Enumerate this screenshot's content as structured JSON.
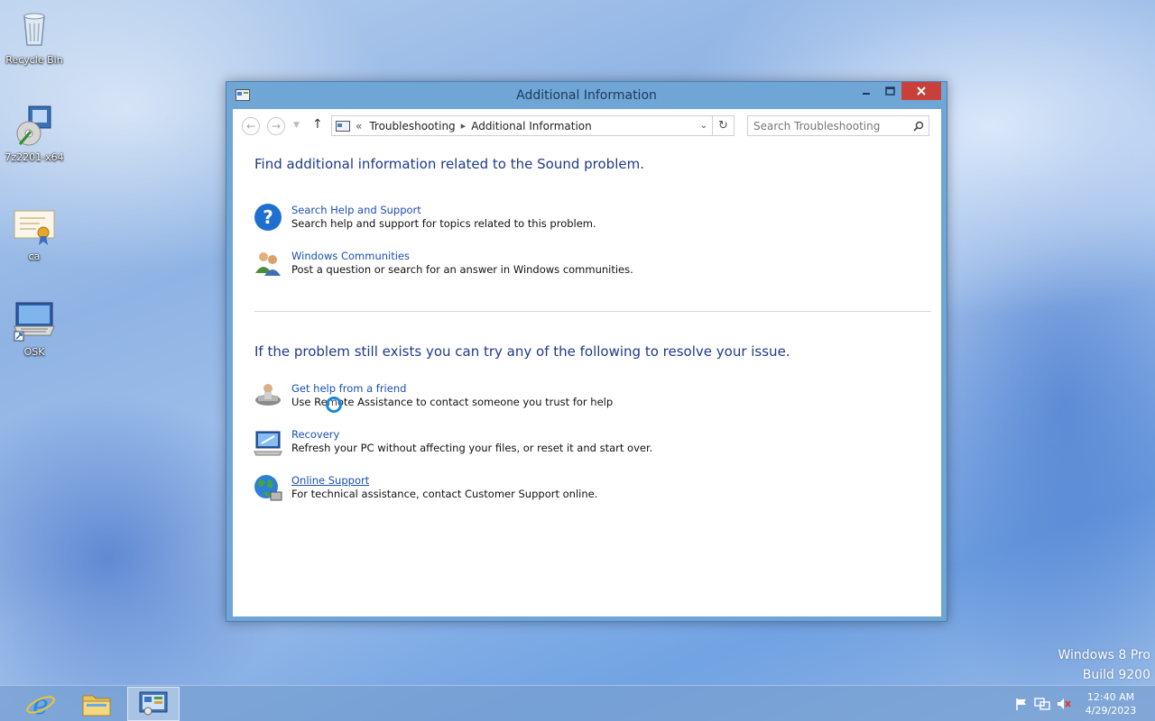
{
  "desktop": {
    "icons": [
      {
        "label": "Recycle Bin",
        "icon": "recycle-bin-icon"
      },
      {
        "label": "7z2201-x64",
        "icon": "installer-icon"
      },
      {
        "label": "ca",
        "icon": "certificate-icon"
      },
      {
        "label": "OSK",
        "icon": "keyboard-shortcut-icon"
      }
    ],
    "watermark": {
      "line1": "Windows 8 Pro",
      "line2": "Build 9200"
    }
  },
  "window": {
    "title": "Additional Information",
    "address": {
      "prefix": "«",
      "crumbs": [
        "Troubleshooting",
        "Additional Information"
      ]
    },
    "search_placeholder": "Search Troubleshooting",
    "section1": {
      "heading": "Find additional information related to the Sound problem.",
      "items": [
        {
          "title": "Search Help and Support",
          "desc": "Search help and support for topics related to this problem.",
          "icon": "help-question-icon"
        },
        {
          "title": "Windows Communities",
          "desc": "Post a question or search for an answer in Windows communities.",
          "icon": "community-users-icon"
        }
      ]
    },
    "section2": {
      "heading": "If the problem still exists you can try any of the following to resolve your issue.",
      "items": [
        {
          "title": "Get help from a friend",
          "desc": "Use Remote Assistance to contact someone you trust for help",
          "icon": "remote-assistance-icon"
        },
        {
          "title": "Recovery",
          "desc": "Refresh your PC without affecting your files, or reset it and start over.",
          "icon": "recovery-icon"
        },
        {
          "title": "Online Support",
          "desc": "For technical assistance, contact Customer Support online.",
          "icon": "globe-icon"
        }
      ]
    }
  },
  "taskbar": {
    "clock": {
      "time": "12:40 AM",
      "date": "4/29/2023"
    }
  },
  "colors": {
    "accent": "#70a6d6",
    "link": "#1a4fb0",
    "heading": "#1e3a8a",
    "close": "#c7413a"
  }
}
